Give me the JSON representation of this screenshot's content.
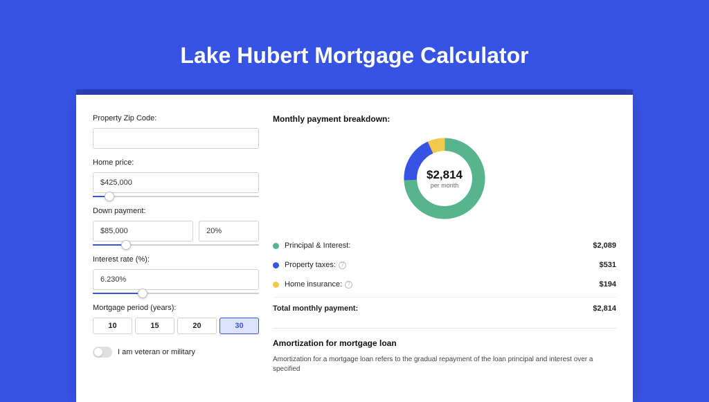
{
  "title": "Lake Hubert Mortgage Calculator",
  "colors": {
    "principal": "#56b48e",
    "taxes": "#3753e4",
    "insurance": "#f2c94c"
  },
  "form": {
    "zip_label": "Property Zip Code:",
    "zip_value": "",
    "home_price_label": "Home price:",
    "home_price_value": "$425,000",
    "home_price_slider_pct": 10,
    "down_payment_label": "Down payment:",
    "down_payment_value": "$85,000",
    "down_payment_pct_value": "20%",
    "down_payment_slider_pct": 20,
    "interest_label": "Interest rate (%):",
    "interest_value": "6.230%",
    "interest_slider_pct": 30,
    "period_label": "Mortgage period (years):",
    "periods": [
      "10",
      "15",
      "20",
      "30"
    ],
    "period_active_index": 3,
    "veteran_label": "I am veteran or military"
  },
  "breakdown": {
    "title": "Monthly payment breakdown:",
    "center_amount": "$2,814",
    "center_sub": "per month",
    "segments": {
      "principal": {
        "fraction": 0.742,
        "label": "Principal & Interest:",
        "value": "$2,089"
      },
      "taxes": {
        "fraction": 0.189,
        "label": "Property taxes:",
        "value": "$531"
      },
      "insurance": {
        "fraction": 0.069,
        "label": "Home insurance:",
        "value": "$194"
      }
    },
    "total_label": "Total monthly payment:",
    "total_value": "$2,814"
  },
  "amortization": {
    "title": "Amortization for mortgage loan",
    "text": "Amortization for a mortgage loan refers to the gradual repayment of the loan principal and interest over a specified"
  }
}
